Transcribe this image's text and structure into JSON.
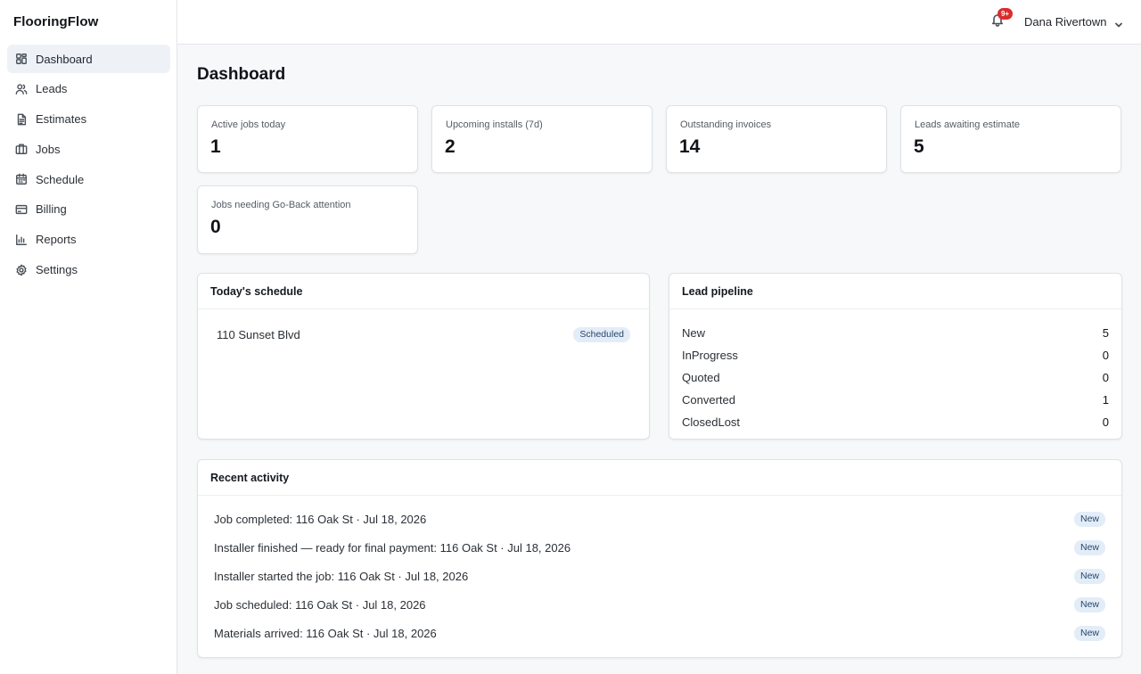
{
  "app": {
    "brand": "FlooringFlow"
  },
  "sidebar": {
    "items": [
      {
        "label": "Dashboard",
        "icon": "grid-icon",
        "active": true
      },
      {
        "label": "Leads",
        "icon": "users-icon"
      },
      {
        "label": "Estimates",
        "icon": "document-icon"
      },
      {
        "label": "Jobs",
        "icon": "briefcase-icon"
      },
      {
        "label": "Schedule",
        "icon": "calendar-icon"
      },
      {
        "label": "Billing",
        "icon": "credit-card-icon"
      },
      {
        "label": "Reports",
        "icon": "bar-chart-icon"
      },
      {
        "label": "Settings",
        "icon": "gear-icon"
      }
    ]
  },
  "topbar": {
    "notifications_badge": "9+",
    "user_name": "Dana Rivertown"
  },
  "main": {
    "title": "Dashboard",
    "stats": [
      {
        "label": "Active jobs today",
        "value": "1"
      },
      {
        "label": "Upcoming installs (7d)",
        "value": "2"
      },
      {
        "label": "Outstanding invoices",
        "value": "14"
      },
      {
        "label": "Leads awaiting estimate",
        "value": "5"
      },
      {
        "label": "Jobs needing Go-Back attention",
        "value": "0"
      }
    ],
    "schedule": {
      "title": "Today's schedule",
      "items": [
        {
          "address": "110 Sunset Blvd",
          "status": "Scheduled"
        }
      ]
    },
    "pipeline": {
      "title": "Lead pipeline",
      "rows": [
        {
          "label": "New",
          "count": "5"
        },
        {
          "label": "InProgress",
          "count": "0"
        },
        {
          "label": "Quoted",
          "count": "0"
        },
        {
          "label": "Converted",
          "count": "1"
        },
        {
          "label": "ClosedLost",
          "count": "0"
        }
      ]
    },
    "activity": {
      "title": "Recent activity",
      "items": [
        {
          "text": "Job completed: 116 Oak St · Jul 18, 2026",
          "badge": "New"
        },
        {
          "text": "Installer finished — ready for final payment: 116 Oak St · Jul 18, 2026",
          "badge": "New"
        },
        {
          "text": "Installer started the job: 116 Oak St · Jul 18, 2026",
          "badge": "New"
        },
        {
          "text": "Job scheduled: 116 Oak St · Jul 18, 2026",
          "badge": "New"
        },
        {
          "text": "Materials arrived: 116 Oak St · Jul 18, 2026",
          "badge": "New"
        }
      ]
    }
  },
  "colors": {
    "accent_active_bg": "#eef2f7",
    "badge_bg": "#e3edf8",
    "notification_red": "#d92d2d"
  }
}
